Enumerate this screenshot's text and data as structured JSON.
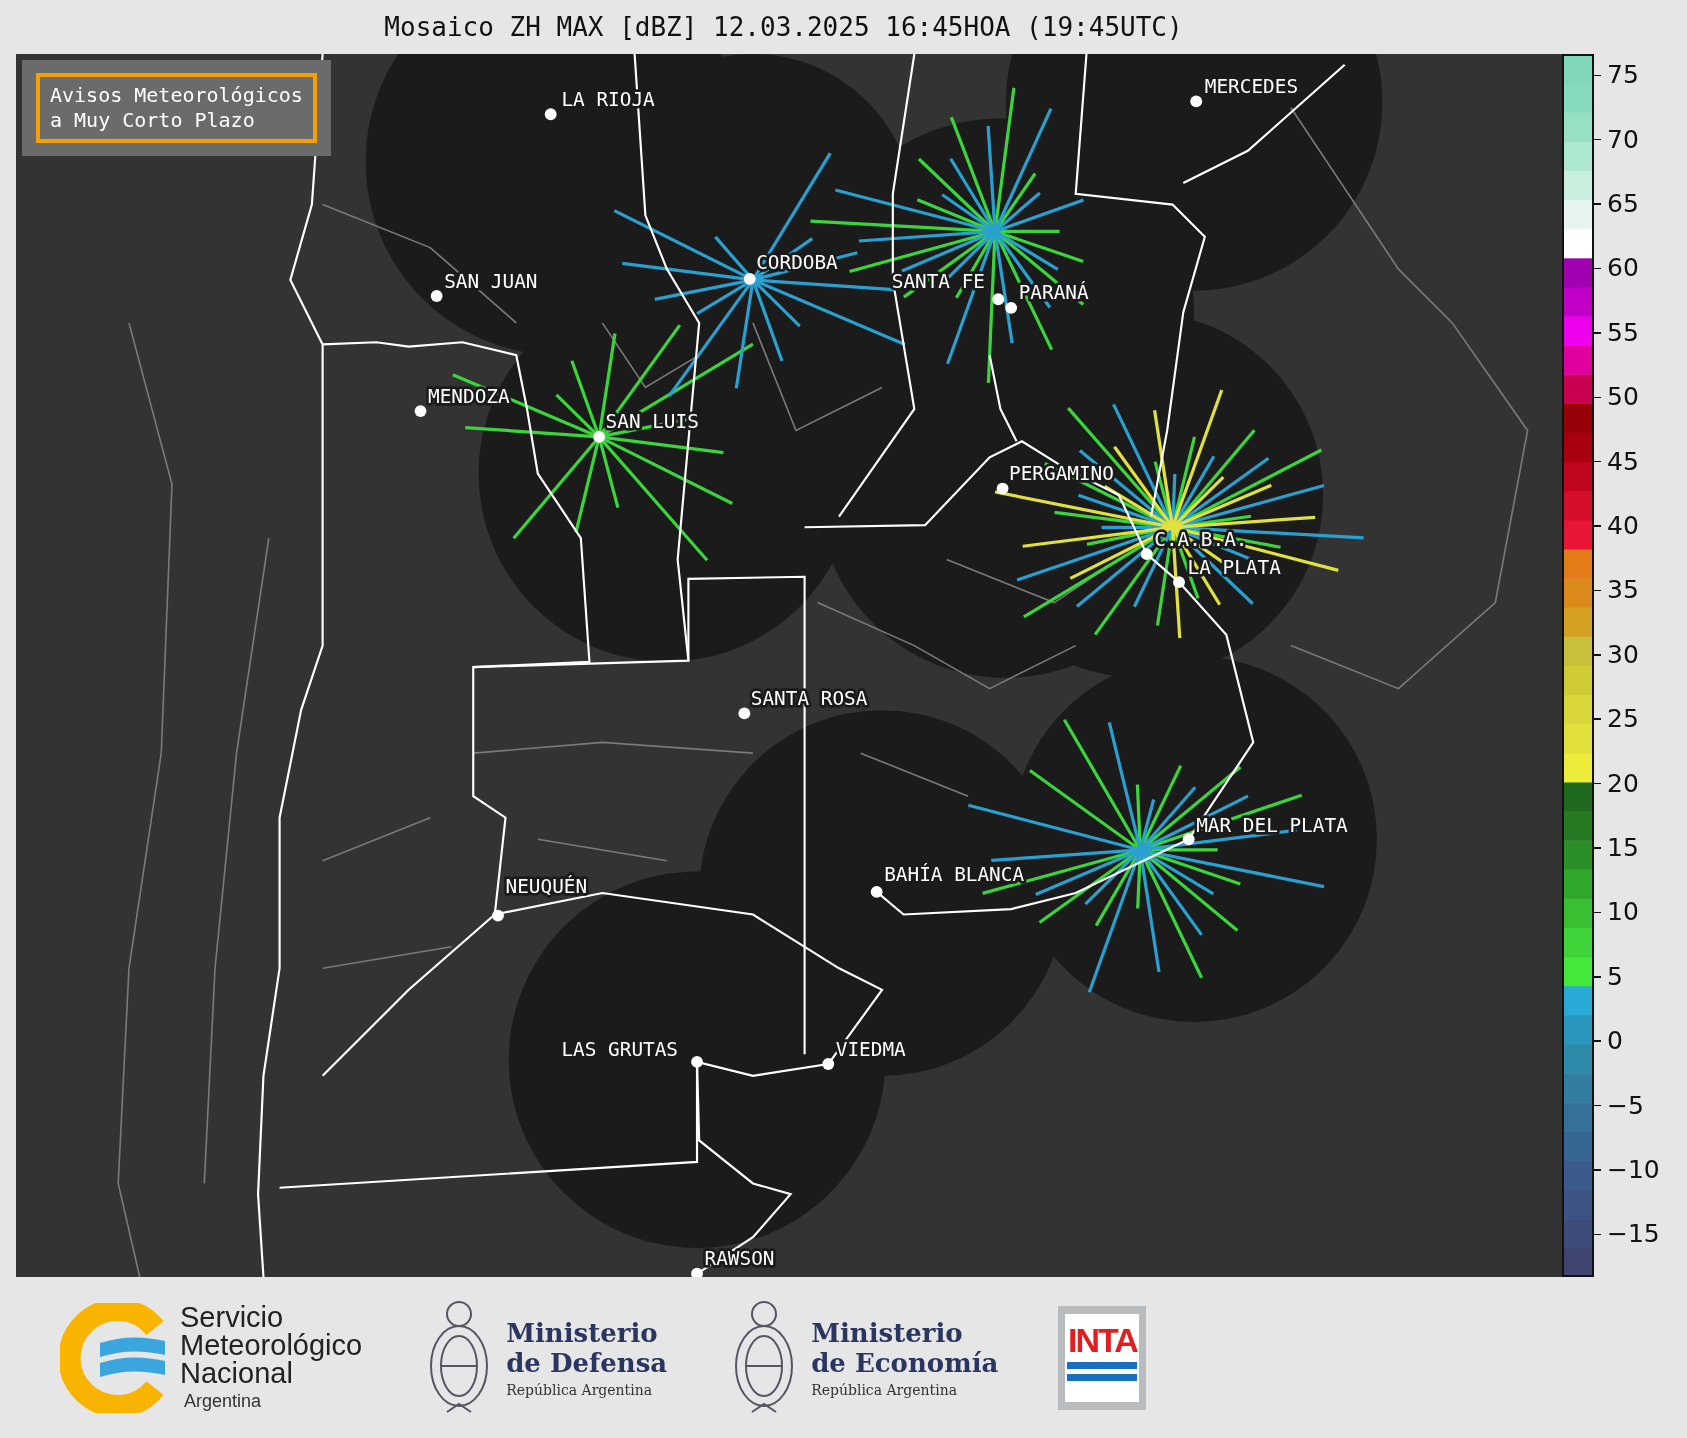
{
  "title": "Mosaico ZH MAX [dBZ] 12.03.2025 16:45HOA (19:45UTC)",
  "notice": {
    "lines": [
      "Avisos Meteorológicos",
      "a Muy Corto Plazo"
    ]
  },
  "cities": [
    {
      "name": "LA RIOJA"
    },
    {
      "name": "SAN JUAN"
    },
    {
      "name": "CORDOBA"
    },
    {
      "name": "SANTA FE"
    },
    {
      "name": "PARANÁ"
    },
    {
      "name": "MENDOZA"
    },
    {
      "name": "SAN LUIS"
    },
    {
      "name": "MERCEDES"
    },
    {
      "name": "PERGAMINO"
    },
    {
      "name": "C.A.B.A."
    },
    {
      "name": "LA PLATA"
    },
    {
      "name": "SANTA ROSA"
    },
    {
      "name": "MAR DEL PLATA"
    },
    {
      "name": "BAHÍA BLANCA"
    },
    {
      "name": "NEUQUÉN"
    },
    {
      "name": "LAS GRUTAS"
    },
    {
      "name": "VIEDMA"
    },
    {
      "name": "RAWSON"
    }
  ],
  "colorbar": {
    "ticks": [
      "75",
      "70",
      "65",
      "60",
      "55",
      "50",
      "45",
      "40",
      "35",
      "30",
      "25",
      "20",
      "15",
      "10",
      "5",
      "0",
      "−5",
      "−10",
      "−15"
    ]
  },
  "logos": [
    {
      "kind": "smn",
      "lines": [
        "Servicio",
        "Meteorológico",
        "Nacional"
      ],
      "subtitle": "Argentina"
    },
    {
      "kind": "ministry",
      "lines": [
        "Ministerio",
        "de Defensa"
      ],
      "subtitle": "República Argentina"
    },
    {
      "kind": "ministry",
      "lines": [
        "Ministerio",
        "de Economía"
      ],
      "subtitle": "República Argentina"
    },
    {
      "kind": "inta",
      "lines": [
        "INTA"
      ]
    }
  ]
}
